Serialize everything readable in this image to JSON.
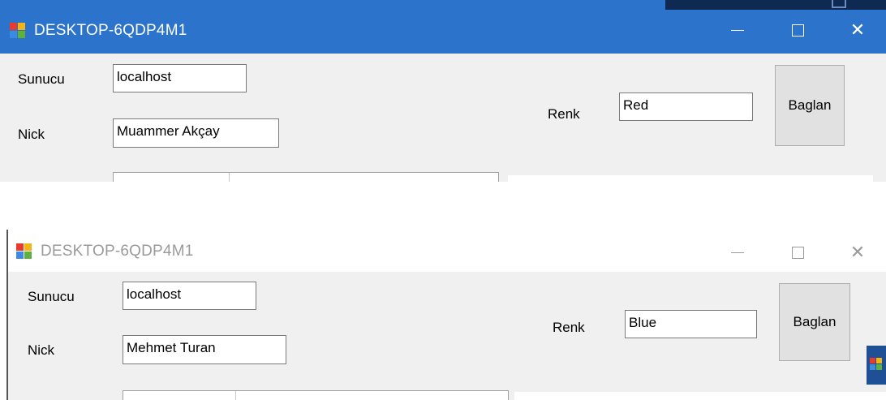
{
  "windows": [
    {
      "title": "DESKTOP-6QDP4M1",
      "labels": {
        "server": "Sunucu",
        "nick": "Nick",
        "color": "Renk"
      },
      "fields": {
        "server": "localhost",
        "nick": "Muammer Akçay",
        "color": "Red"
      },
      "connect_button": "Baglan",
      "state": "active"
    },
    {
      "title": "DESKTOP-6QDP4M1",
      "labels": {
        "server": "Sunucu",
        "nick": "Nick",
        "color": "Renk"
      },
      "fields": {
        "server": "localhost",
        "nick": "Mehmet Turan",
        "color": "Blue"
      },
      "connect_button": "Baglan",
      "state": "inactive"
    }
  ],
  "colors": {
    "active_titlebar": "#2b73cb",
    "inactive_title_text": "#9a9a9a",
    "client_background": "#f0f0f0"
  },
  "icons": [
    "app-icon",
    "minimize-icon",
    "maximize-icon",
    "close-icon"
  ]
}
